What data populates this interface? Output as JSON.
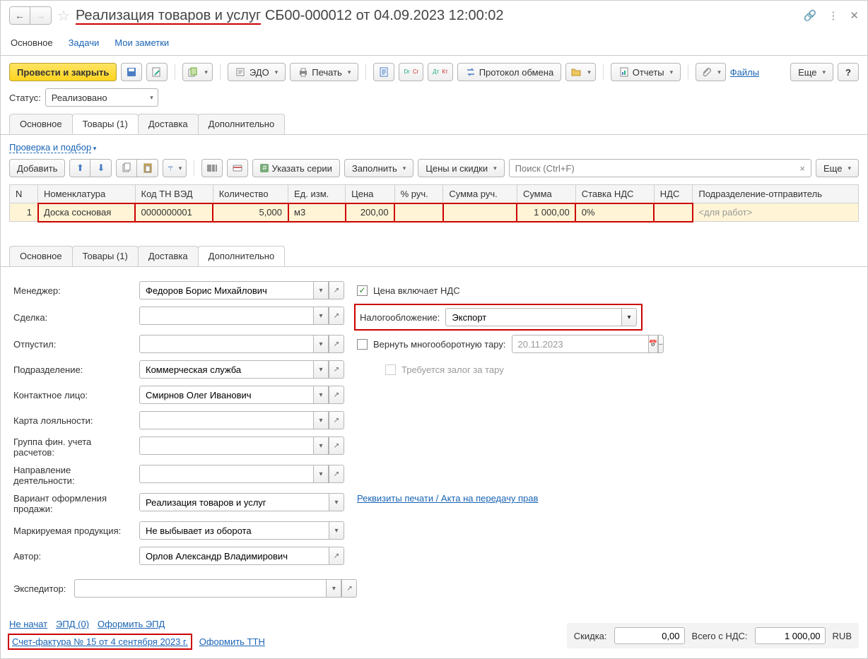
{
  "title": {
    "highlighted": "Реализация товаров и услуг",
    "rest": " СБ00-000012 от 04.09.2023 12:00:02"
  },
  "topTabs": {
    "main": "Основное",
    "tasks": "Задачи",
    "notes": "Мои заметки"
  },
  "toolbar": {
    "postAndClose": "Провести и закрыть",
    "edo": "ЭДО",
    "print": "Печать",
    "protocol": "Протокол обмена",
    "reports": "Отчеты",
    "files": "Файлы",
    "more": "Еще",
    "help": "?"
  },
  "status": {
    "label": "Статус:",
    "value": "Реализовано"
  },
  "subTabs": {
    "main": "Основное",
    "goods": "Товары (1)",
    "delivery": "Доставка",
    "extra": "Дополнительно"
  },
  "checkLink": "Проверка и подбор",
  "tableToolbar": {
    "add": "Добавить",
    "series": "Указать серии",
    "fill": "Заполнить",
    "prices": "Цены и скидки",
    "searchPlaceholder": "Поиск (Ctrl+F)",
    "more": "Еще"
  },
  "columns": [
    "N",
    "Номенклатура",
    "Код ТН ВЭД",
    "Количество",
    "Ед. изм.",
    "Цена",
    "% руч.",
    "Сумма руч.",
    "Сумма",
    "Ставка НДС",
    "НДС",
    "Подразделение-отправитель"
  ],
  "row": {
    "n": "1",
    "name": "Доска сосновая",
    "tnved": "0000000001",
    "qty": "5,000",
    "uom": "м3",
    "price": "200,00",
    "pct": "",
    "sumMan": "",
    "sum": "1 000,00",
    "vatRate": "0%",
    "vat": "",
    "division": "<для работ>"
  },
  "form": {
    "managerLabel": "Менеджер:",
    "manager": "Федоров Борис Михайлович",
    "dealLabel": "Сделка:",
    "deal": "",
    "releasedLabel": "Отпустил:",
    "released": "",
    "divisionLabel": "Подразделение:",
    "division": "Коммерческая служба",
    "contactLabel": "Контактное лицо:",
    "contact": "Смирнов Олег Иванович",
    "loyaltyLabel": "Карта лояльности:",
    "loyalty": "",
    "finGroupLabel": "Группа фин. учета расчетов:",
    "finGroup": "",
    "activityLabel": "Направление деятельности:",
    "activity": "",
    "variantLabel": "Вариант оформления продажи:",
    "variant": "Реализация товаров и услуг",
    "markingLabel": "Маркируемая продукция:",
    "marking": "Не выбывает из оборота",
    "authorLabel": "Автор:",
    "author": "Орлов Александр Владимирович",
    "forwarderLabel": "Экспедитор:",
    "forwarder": "",
    "priceInclVat": "Цена включает НДС",
    "taxLabel": "Налогообложение:",
    "tax": "Экспорт",
    "returnTare": "Вернуть многооборотную тару:",
    "returnDate": "20.11.2023",
    "requireDeposit": "Требуется залог за тару",
    "requisitesLink": "Реквизиты печати / Акта на передачу прав"
  },
  "footer": {
    "notStarted": "Не начат",
    "epd": "ЭПД (0)",
    "issueEpd": "Оформить ЭПД",
    "invoice": "Счет-фактура № 15 от 4 сентября 2023 г.",
    "issueTtn": "Оформить ТТН",
    "discountLabel": "Скидка:",
    "discount": "0,00",
    "totalLabel": "Всего с НДС:",
    "total": "1 000,00",
    "currency": "RUB"
  }
}
